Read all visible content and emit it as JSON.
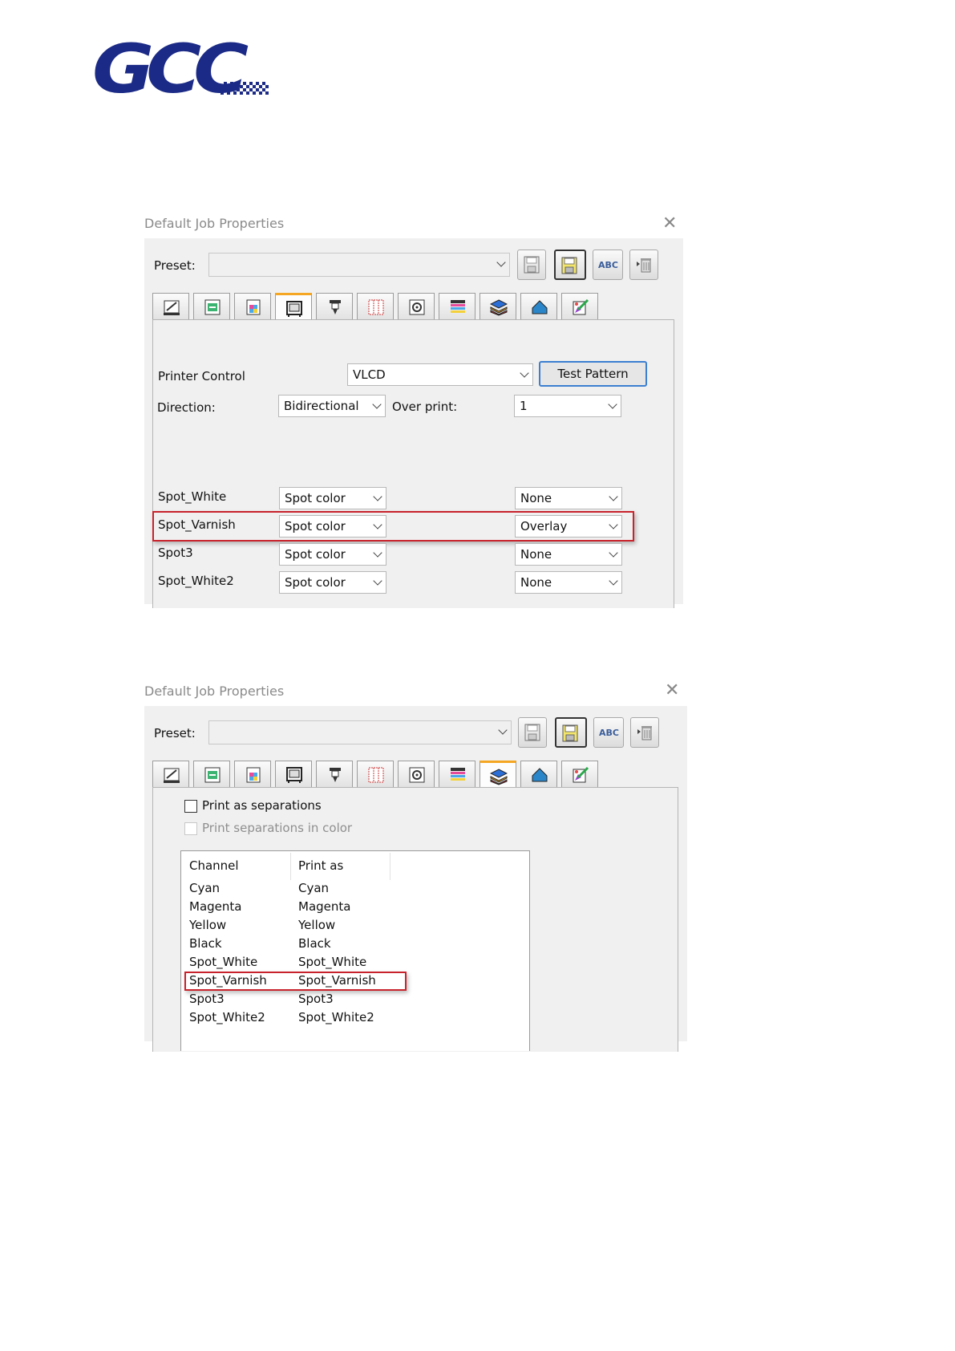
{
  "logo": {
    "text": "GCC"
  },
  "dialog1": {
    "title": "Default Job Properties",
    "close_glyph": "✕",
    "preset_label": "Preset:",
    "preset_value": "",
    "toolbar_buttons": [
      "save-icon",
      "save-as-icon",
      "rename-icon",
      "delete-icon"
    ],
    "rename_text": "ABC",
    "tabs": [
      "media-icon",
      "layout-icon",
      "color-icon",
      "printer-icon",
      "tool-icon",
      "grid-icon",
      "target-icon",
      "channels-icon",
      "layers-icon",
      "shape-icon",
      "spot-color-icon"
    ],
    "selected_tab": 3,
    "printer_control_label": "Printer Control",
    "printer_control_value": "VLCD",
    "test_pattern_label": "Test Pattern",
    "direction_label": "Direction:",
    "direction_value": "Bidirectional",
    "overprint_label": "Over print:",
    "overprint_value": "1",
    "spots": [
      {
        "name": "Spot_White",
        "type": "Spot color",
        "mode": "None"
      },
      {
        "name": "Spot_Varnish",
        "type": "Spot color",
        "mode": "Overlay"
      },
      {
        "name": "Spot3",
        "type": "Spot color",
        "mode": "None"
      },
      {
        "name": "Spot_White2",
        "type": "Spot color",
        "mode": "None"
      }
    ]
  },
  "dialog2": {
    "title": "Default Job Properties",
    "close_glyph": "✕",
    "preset_label": "Preset:",
    "preset_value": "",
    "rename_text": "ABC",
    "selected_tab": 8,
    "print_separations_label": "Print as separations",
    "print_separations_color_label": "Print separations in color",
    "columns": [
      "Channel",
      "Print as"
    ],
    "rows": [
      [
        "Cyan",
        "Cyan"
      ],
      [
        "Magenta",
        "Magenta"
      ],
      [
        "Yellow",
        "Yellow"
      ],
      [
        "Black",
        "Black"
      ],
      [
        "Spot_White",
        "Spot_White"
      ],
      [
        "Spot_Varnish",
        "Spot_Varnish"
      ],
      [
        "Spot3",
        "Spot3"
      ],
      [
        "Spot_White2",
        "Spot_White2"
      ]
    ]
  },
  "colors": {
    "highlight": "#c8232c",
    "brand": "#1b2a86",
    "tab_selected": "#f5a623"
  }
}
